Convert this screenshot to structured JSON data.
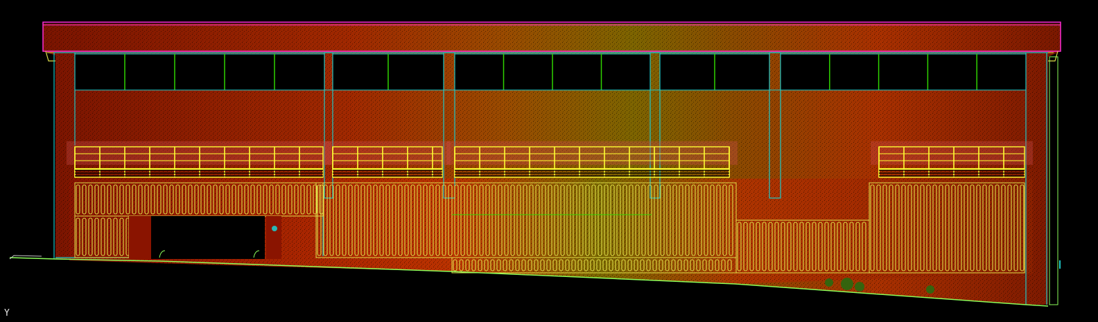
{
  "drawing": {
    "ucs_label": "Y",
    "colors": {
      "background": "#000000",
      "roof_outline": "#ff2bd6",
      "frame": "#1ec8c8",
      "window_mullion": "#2fd400",
      "louver": "#ffff33",
      "cladding": "#e0e04a",
      "ground": "#8cff5a",
      "wall_warm": "#9a1a00",
      "wall_hot": "#c82a00",
      "wall_mid": "#8a4200",
      "wall_green": "#6a6a00"
    },
    "layers": [
      {
        "name": "point-cloud-facade",
        "color": "wall_warm"
      },
      {
        "name": "roof-parapet",
        "color": "roof_outline"
      },
      {
        "name": "structural-frame",
        "color": "frame"
      },
      {
        "name": "upper-glazing",
        "color": "window_mullion"
      },
      {
        "name": "sun-louvers",
        "color": "louver"
      },
      {
        "name": "perforated-cladding",
        "color": "cladding"
      },
      {
        "name": "ground-line",
        "color": "ground"
      }
    ]
  }
}
